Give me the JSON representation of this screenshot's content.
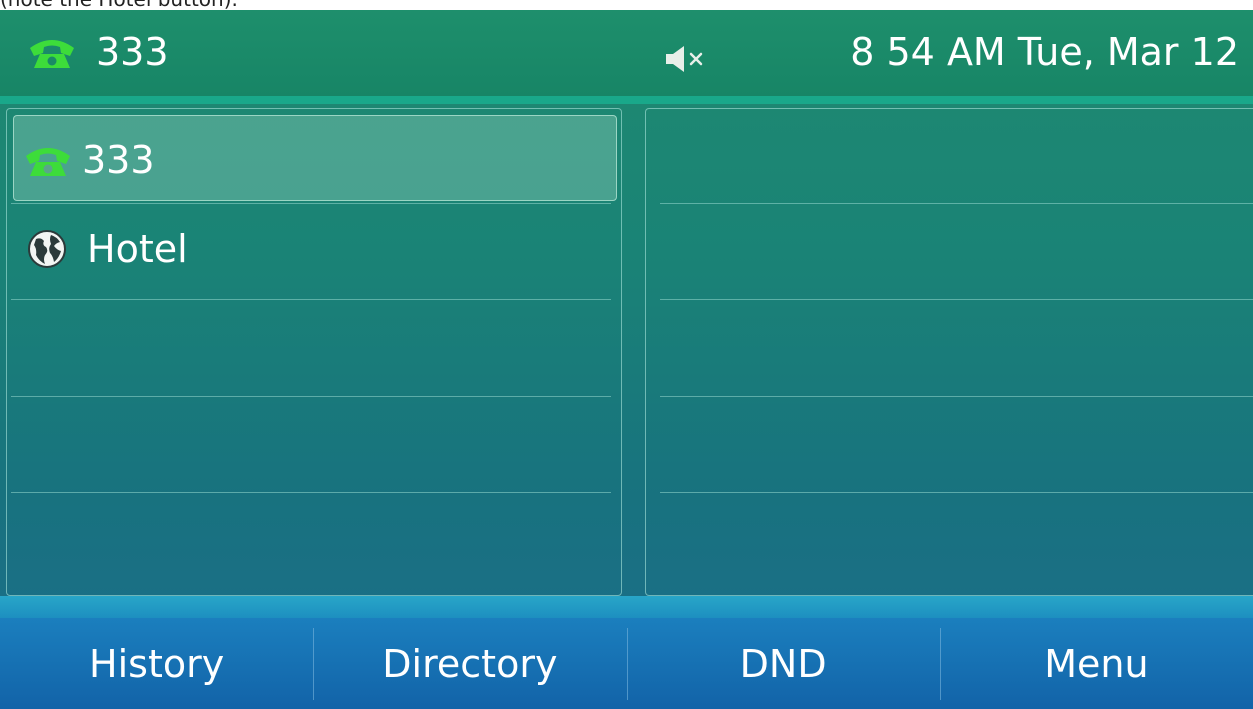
{
  "caption": "(note the Hotel button).",
  "status_bar": {
    "account": "333",
    "datetime": "8 54 AM Tue, Mar 12",
    "icons": {
      "account": "green-phone-handset-icon",
      "volume": "speaker-muted-icon"
    }
  },
  "line_keys": [
    {
      "label": "333",
      "icon": "green-phone-handset-icon",
      "selected": true
    },
    {
      "label": "Hotel",
      "icon": "globe-icon",
      "selected": false
    }
  ],
  "softkeys": [
    {
      "label": "History"
    },
    {
      "label": "Directory"
    },
    {
      "label": "DND"
    },
    {
      "label": "Menu"
    }
  ],
  "colors": {
    "phone_icon_green": "#3ddc3a",
    "status_bar": "#1e8f6c",
    "softkey_bar": "#1b7fbe"
  }
}
